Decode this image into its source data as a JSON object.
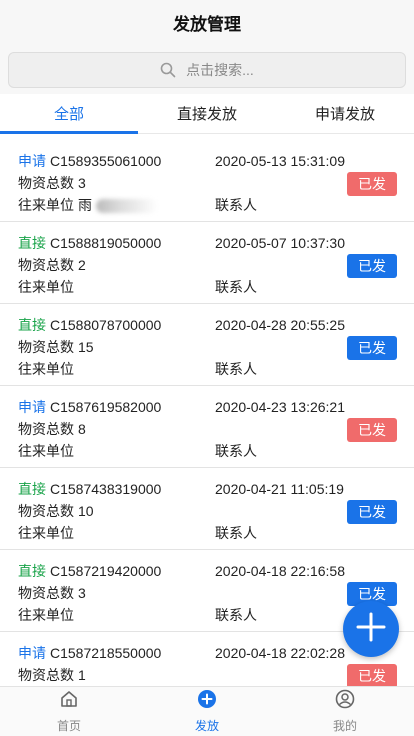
{
  "header": {
    "title": "发放管理"
  },
  "search": {
    "placeholder": "点击搜索..."
  },
  "tabs": [
    {
      "label": "全部",
      "active": true
    },
    {
      "label": "直接发放",
      "active": false
    },
    {
      "label": "申请发放",
      "active": false
    }
  ],
  "labels": {
    "total_prefix": "物资总数",
    "unit_label": "往来单位",
    "contact_label": "联系人"
  },
  "records": [
    {
      "type": "申请",
      "code": "C1589355061000",
      "datetime": "2020-05-13 15:31:09",
      "total": "3",
      "unit": "雨",
      "status": "已发",
      "status_color": "#f06b6b"
    },
    {
      "type": "直接",
      "code": "C1588819050000",
      "datetime": "2020-05-07 10:37:30",
      "total": "2",
      "unit": "",
      "status": "已发",
      "status_color": "#1a73e8"
    },
    {
      "type": "直接",
      "code": "C1588078700000",
      "datetime": "2020-04-28 20:55:25",
      "total": "15",
      "unit": "",
      "status": "已发",
      "status_color": "#1a73e8"
    },
    {
      "type": "申请",
      "code": "C1587619582000",
      "datetime": "2020-04-23 13:26:21",
      "total": "8",
      "unit": "",
      "status": "已发",
      "status_color": "#f06b6b"
    },
    {
      "type": "直接",
      "code": "C1587438319000",
      "datetime": "2020-04-21 11:05:19",
      "total": "10",
      "unit": "",
      "status": "已发",
      "status_color": "#1a73e8"
    },
    {
      "type": "直接",
      "code": "C1587219420000",
      "datetime": "2020-04-18 22:16:58",
      "total": "3",
      "unit": "",
      "status": "已发",
      "status_color": "#1a73e8"
    },
    {
      "type": "申请",
      "code": "C1587218550000",
      "datetime": "2020-04-18 22:02:28",
      "total": "1",
      "unit": "",
      "status": "已发",
      "status_color": "#f06b6b"
    }
  ],
  "fab": {
    "icon": "plus-icon"
  },
  "tabbar": [
    {
      "label": "首页",
      "icon": "home-icon",
      "active": false
    },
    {
      "label": "发放",
      "icon": "add-circle-icon",
      "active": true
    },
    {
      "label": "我的",
      "icon": "user-icon",
      "active": false
    }
  ],
  "colors": {
    "accent": "#1a73e8",
    "apply": "#1a73e8",
    "direct": "#1aa34a",
    "issued_red": "#f06b6b"
  }
}
